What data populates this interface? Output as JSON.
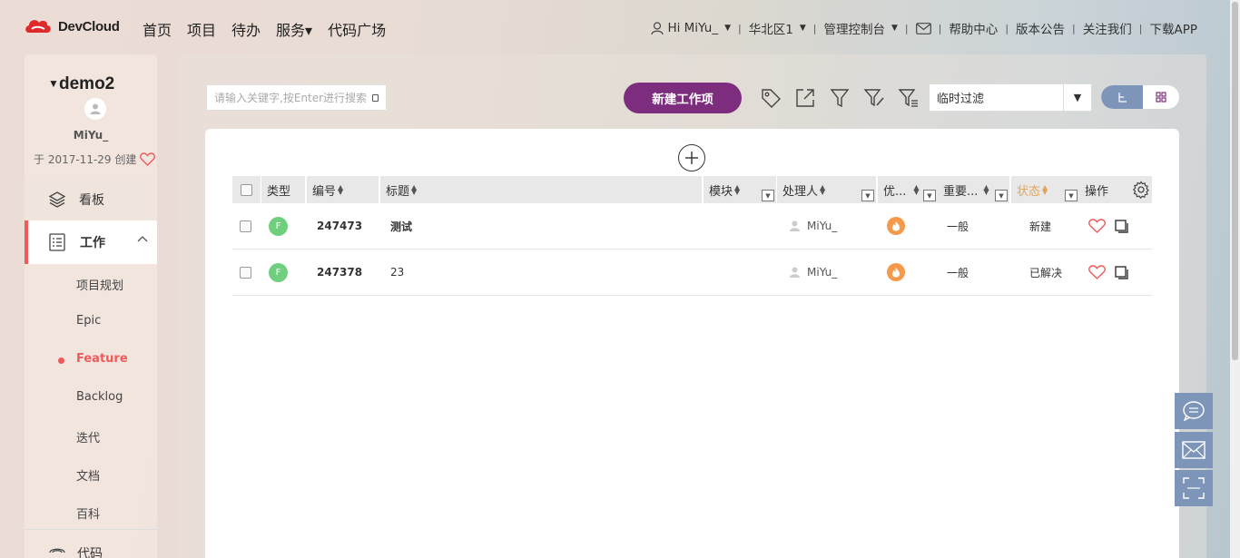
{
  "topnav": {
    "logo_text": "DevCloud",
    "main": [
      "首页",
      "项目",
      "待办",
      "服务▾",
      "代码广场"
    ],
    "user": "Hi MiYu_",
    "region": "华北区1",
    "console": "管理控制台",
    "help": "帮助中心",
    "notice": "版本公告",
    "follow": "关注我们",
    "download": "下载APP",
    "separator": "|"
  },
  "sidebar": {
    "project": "demo2",
    "owner": "MiYu_",
    "created": "于 2017-11-29 创建",
    "kanban": "看板",
    "work": "工作",
    "subitems": [
      "项目规划",
      "Epic",
      "Feature",
      "Backlog",
      "迭代",
      "文档",
      "百科"
    ],
    "active_sub": "Feature",
    "code": "代码"
  },
  "toolbar": {
    "search_placeholder": "请输入关键字,按Enter进行搜索",
    "new_button": "新建工作项",
    "filter_value": "临时过滤"
  },
  "table": {
    "columns": [
      "类型",
      "编号",
      "标题",
      "模块",
      "处理人",
      "优...",
      "重要...",
      "状态",
      "操作"
    ],
    "rows": [
      {
        "type": "F",
        "id": "247473",
        "title": "测试",
        "assignee": "MiYu_",
        "importance": "一般",
        "status": "新建"
      },
      {
        "type": "F",
        "id": "247378",
        "title": "23",
        "assignee": "MiYu_",
        "importance": "一般",
        "status": "已解决"
      }
    ]
  },
  "colors": {
    "accent": "#7d2d7d",
    "active": "#ef5a5a",
    "float": "#7d95b8",
    "type_badge": "#6fcf7f",
    "priority": "#f59a4a",
    "status_header": "#e2a45c"
  }
}
